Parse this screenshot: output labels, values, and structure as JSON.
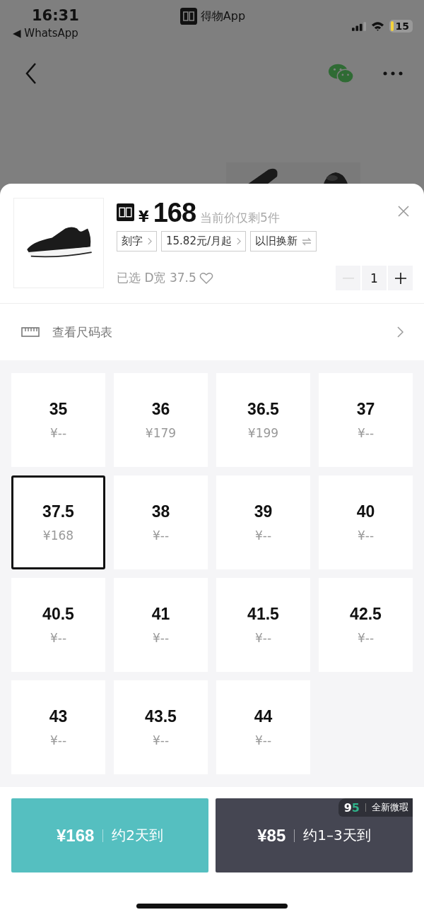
{
  "status_bar": {
    "time": "16:31",
    "back_app": "◀ WhatsApp",
    "center_app": "得物App",
    "battery": "15"
  },
  "product": {
    "price_symbol": "¥",
    "price": "168",
    "stock_note": "当前价仅剩5件",
    "tags": [
      {
        "label": "刻字",
        "kind": "chevron"
      },
      {
        "label": "15.82元/月起",
        "kind": "chevron"
      },
      {
        "label": "以旧换新",
        "kind": "swap"
      }
    ],
    "selected_label": "已选 D宽 37.5",
    "favorited": false,
    "quantity": "1",
    "decrease_disabled": true
  },
  "size_chart_link": "查看尺码表",
  "sizes": [
    {
      "size": "35",
      "price": "¥--",
      "selected": false
    },
    {
      "size": "36",
      "price": "¥179",
      "selected": false
    },
    {
      "size": "36.5",
      "price": "¥199",
      "selected": false
    },
    {
      "size": "37",
      "price": "¥--",
      "selected": false
    },
    {
      "size": "37.5",
      "price": "¥168",
      "selected": true
    },
    {
      "size": "38",
      "price": "¥--",
      "selected": false
    },
    {
      "size": "39",
      "price": "¥--",
      "selected": false
    },
    {
      "size": "40",
      "price": "¥--",
      "selected": false
    },
    {
      "size": "40.5",
      "price": "¥--",
      "selected": false
    },
    {
      "size": "41",
      "price": "¥--",
      "selected": false
    },
    {
      "size": "41.5",
      "price": "¥--",
      "selected": false
    },
    {
      "size": "42.5",
      "price": "¥--",
      "selected": false
    },
    {
      "size": "43",
      "price": "¥--",
      "selected": false
    },
    {
      "size": "43.5",
      "price": "¥--",
      "selected": false
    },
    {
      "size": "44",
      "price": "¥--",
      "selected": false
    }
  ],
  "buy_buttons": [
    {
      "price": "¥168",
      "delivery": "约2天到",
      "kind": "new"
    },
    {
      "price": "¥85",
      "delivery": "约1–3天到",
      "kind": "used",
      "badge_logo": "95",
      "badge_text": "全新微瑕"
    }
  ]
}
